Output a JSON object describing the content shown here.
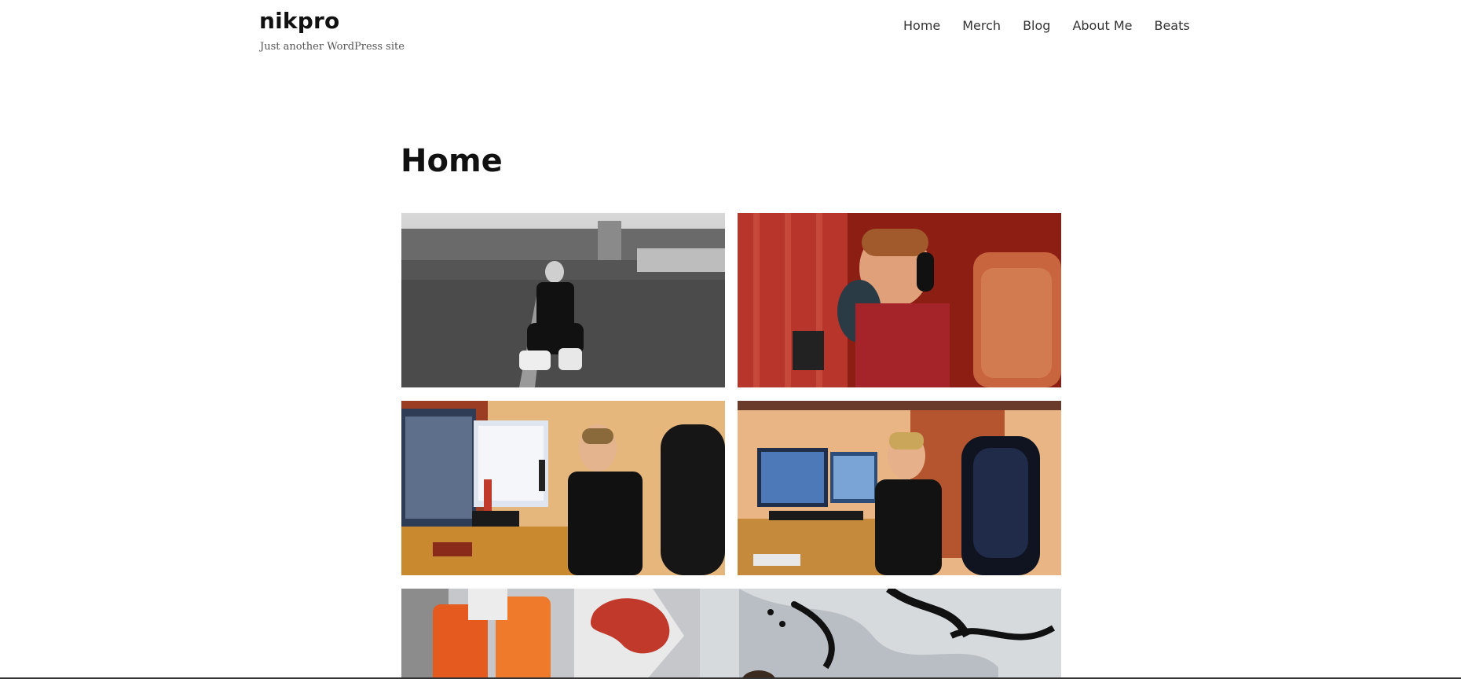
{
  "site": {
    "title": "nikpro",
    "tagline": "Just another WordPress site"
  },
  "nav": {
    "items": [
      {
        "label": "Home"
      },
      {
        "label": "Merch"
      },
      {
        "label": "Blog"
      },
      {
        "label": "About Me"
      },
      {
        "label": "Beats"
      }
    ]
  },
  "page": {
    "title": "Home"
  },
  "gallery": {
    "images": [
      {
        "alt": "photo-street-sitting"
      },
      {
        "alt": "photo-recording-red-room"
      },
      {
        "alt": "photo-studio-desk-side"
      },
      {
        "alt": "photo-studio-desk-front"
      },
      {
        "alt": "photo-graffiti-wall"
      }
    ]
  },
  "colors": {
    "text": "#111111",
    "nav_text": "#333333",
    "tagline": "#555555",
    "background": "#ffffff"
  }
}
